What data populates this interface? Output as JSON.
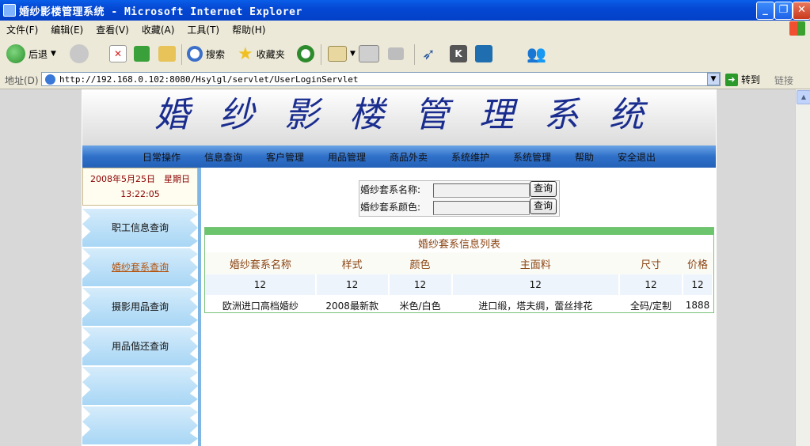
{
  "window": {
    "title": "婚纱影楼管理系统 - Microsoft Internet Explorer",
    "controls": [
      "_",
      "❐",
      "✕"
    ]
  },
  "menu": [
    "文件(F)",
    "编辑(E)",
    "查看(V)",
    "收藏(A)",
    "工具(T)",
    "帮助(H)"
  ],
  "toolbar": {
    "back": "后退",
    "search": "搜索",
    "favorites": "收藏夹"
  },
  "address": {
    "label": "地址(D)",
    "url": "http://192.168.0.102:8080/Hsylgl/servlet/UserLoginServlet",
    "go": "转到",
    "links": "链接"
  },
  "page": {
    "banner_title": "婚纱影楼管理系统",
    "nav": [
      "日常操作",
      "信息查询",
      "客户管理",
      "用品管理",
      "商品外卖",
      "系统维护",
      "系统管理",
      "帮助",
      "安全退出"
    ],
    "date_line": "2008年5月25日　星期日",
    "time_line": "13:22:05",
    "sidebar": [
      "职工信息查询",
      "婚纱套系查询",
      "摄影用品查询",
      "用品偕还查询",
      "",
      ""
    ],
    "sidebar_active_index": 1,
    "search": {
      "name_label": "婚纱套系名称:",
      "color_label": "婚纱套系颜色:",
      "button": "查询"
    },
    "table": {
      "caption": "婚纱套系信息列表",
      "headers": [
        "婚纱套系名称",
        "样式",
        "颜色",
        "主面料",
        "尺寸",
        "价格"
      ],
      "rows": [
        [
          "12",
          "12",
          "12",
          "12",
          "12",
          "12"
        ],
        [
          "欧洲进口高档婚纱",
          "2008最新款",
          "米色/白色",
          "进口缎，塔夫绸，蕾丝排花",
          "全码/定制",
          "1888"
        ]
      ]
    }
  },
  "colors": {
    "titlebar": "#0548d3",
    "banner_text": "#1a2d8f",
    "navbar": "#2f70c9",
    "table_header_text": "#8b4513",
    "table_border": "#79c27a"
  }
}
